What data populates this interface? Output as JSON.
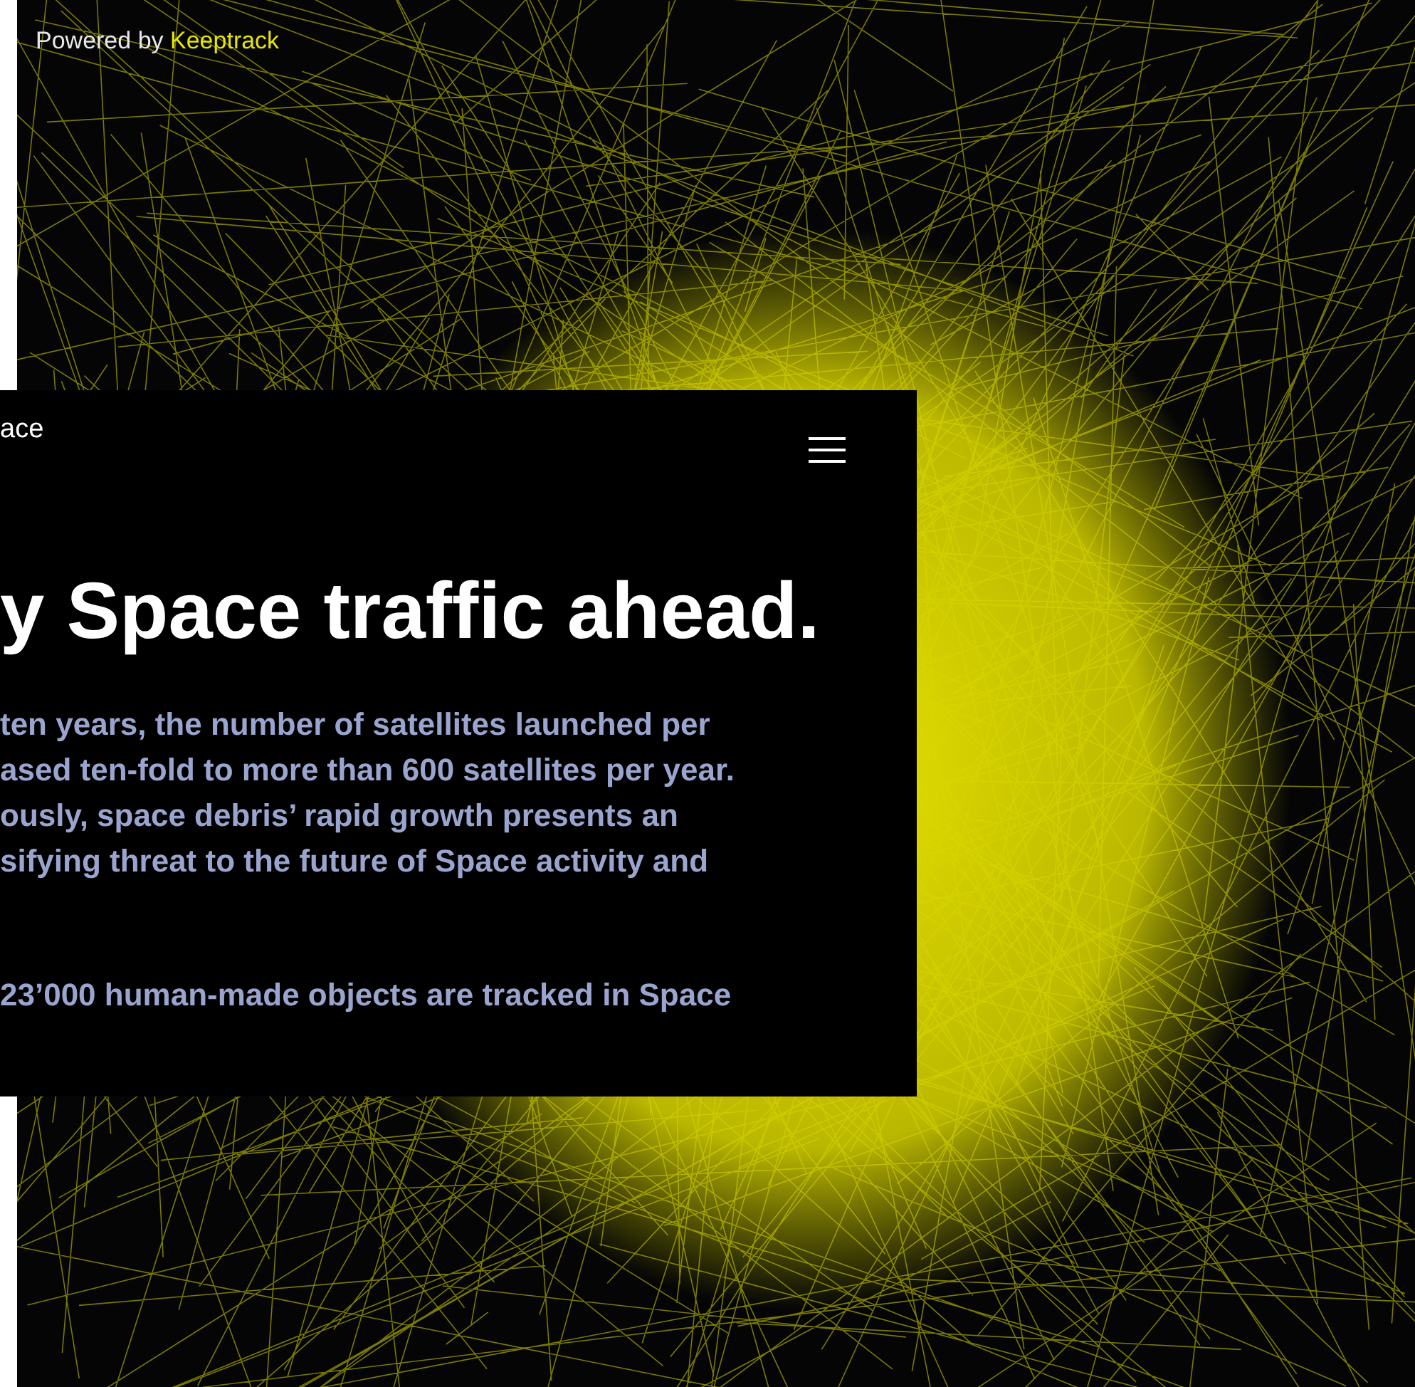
{
  "credit": {
    "text": "Powered by",
    "link": "Keeptrack"
  },
  "panel": {
    "brand": "ace",
    "heading": "y Space traffic ahead.",
    "paragraphs": [
      [
        "ten years, the number of satellites launched per",
        "ased ten-fold to more than 600 satellites per year.",
        "ously, space debris’ rapid growth presents an",
        "sifying threat to the future of Space activity and"
      ],
      [
        "23’000 human-made objects are tracked in Space"
      ]
    ]
  }
}
